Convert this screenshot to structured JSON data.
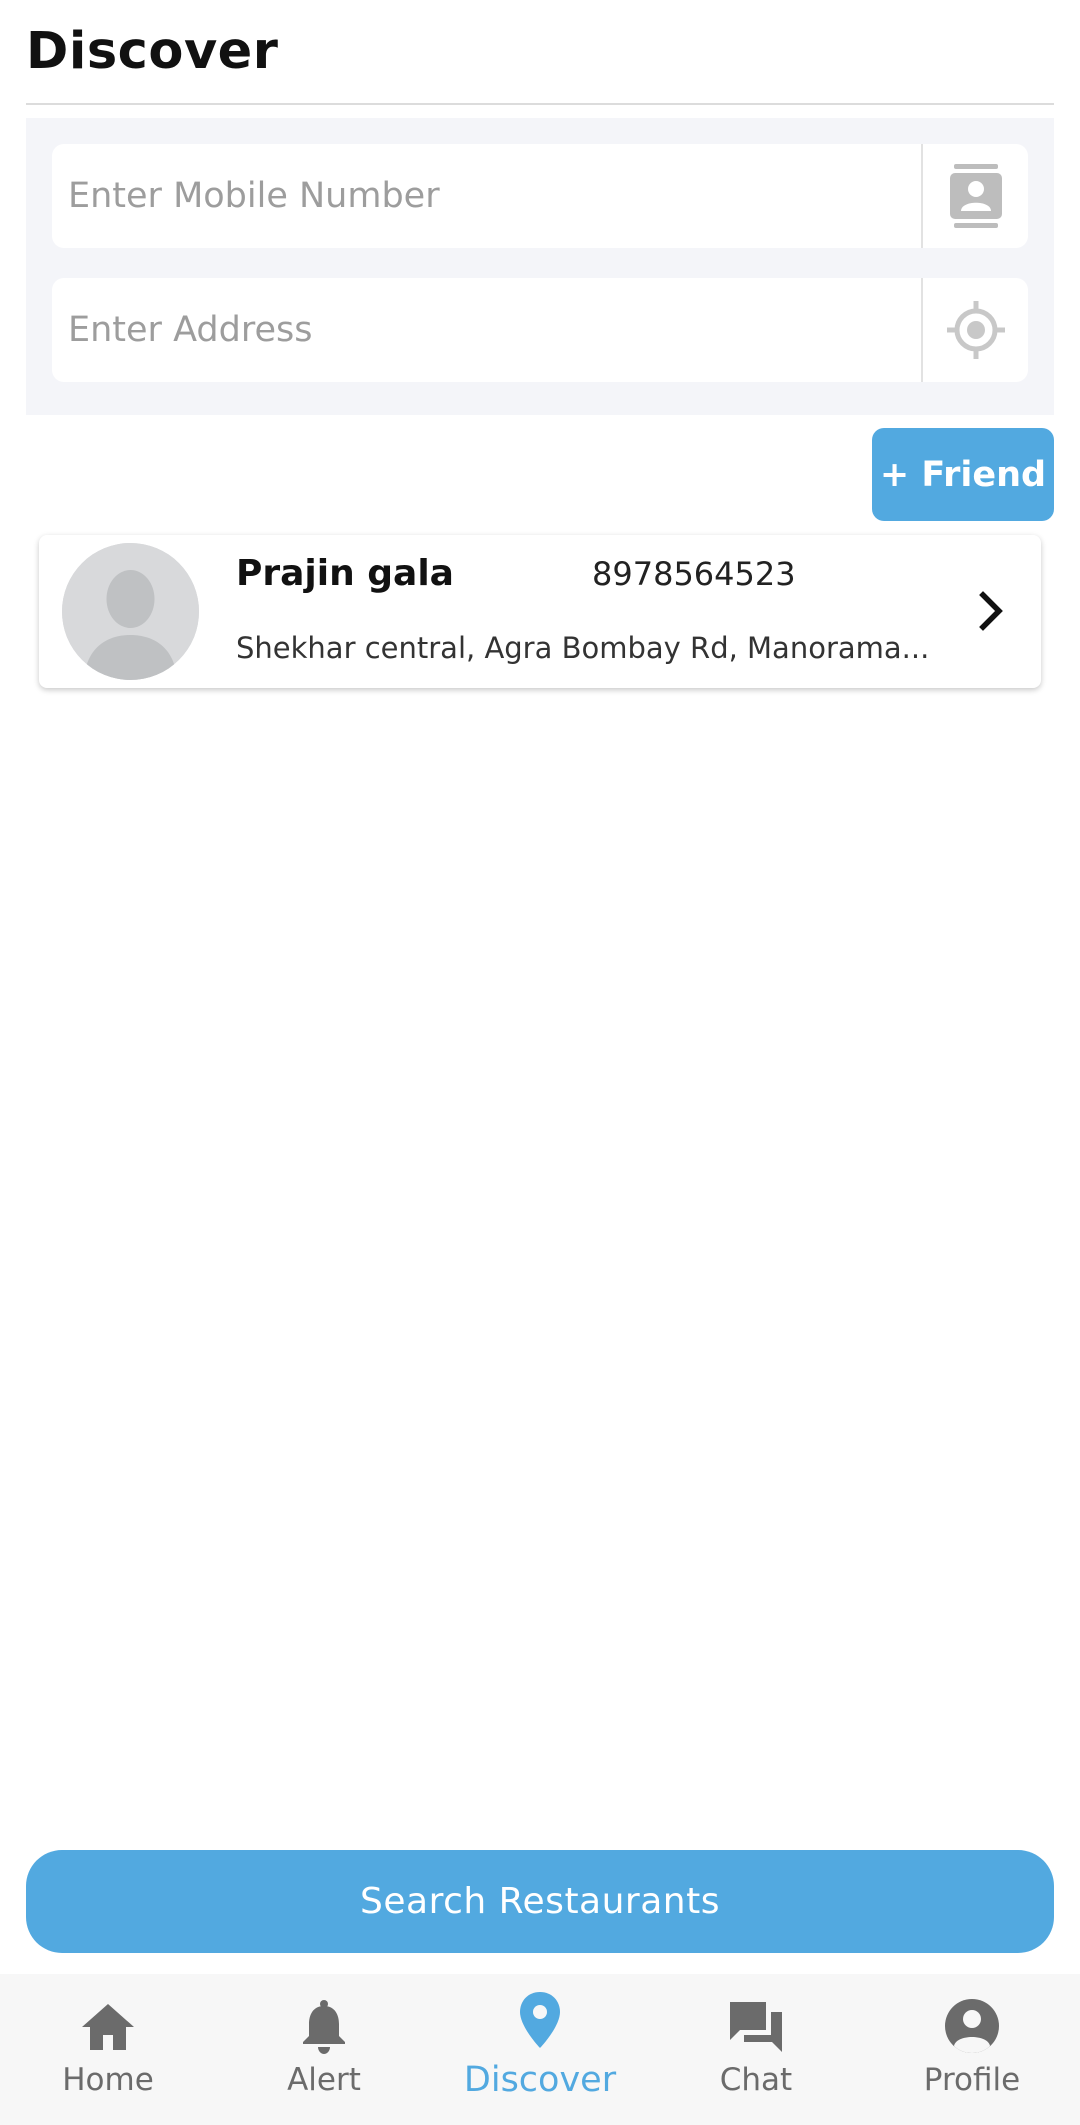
{
  "header": {
    "title": "Discover"
  },
  "form": {
    "mobile_placeholder": "Enter Mobile Number",
    "mobile_value": "",
    "address_placeholder": "Enter Address",
    "address_value": ""
  },
  "add_friend_label": "+ Friend",
  "friends": [
    {
      "name": "Prajin gala",
      "phone": "8978564523",
      "address": "Shekhar central, Agra Bombay Rd, Manorama..."
    }
  ],
  "search_button_label": "Search Restaurants",
  "bottom_nav": {
    "active": "Discover",
    "items": [
      {
        "label": "Home",
        "icon": "home-icon"
      },
      {
        "label": "Alert",
        "icon": "bell-icon"
      },
      {
        "label": "Discover",
        "icon": "location-pin-icon"
      },
      {
        "label": "Chat",
        "icon": "chat-icon"
      },
      {
        "label": "Profile",
        "icon": "account-circle-icon"
      }
    ]
  },
  "colors": {
    "accent": "#52a9e0",
    "panel_bg": "#f4f5f9",
    "nav_bg": "#f7f7f7",
    "nav_inactive": "#6b6b6b",
    "icon_gray": "#bdbdbd"
  }
}
